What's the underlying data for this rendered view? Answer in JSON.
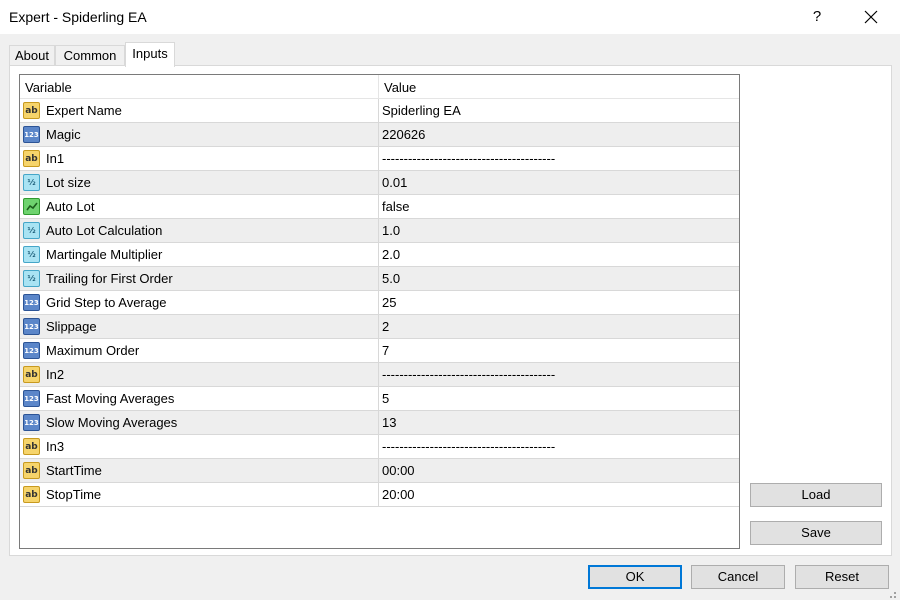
{
  "window": {
    "title": "Expert - Spiderling EA",
    "help_label": "?"
  },
  "tabs": [
    {
      "label": "About"
    },
    {
      "label": "Common"
    },
    {
      "label": "Inputs"
    }
  ],
  "active_tab": "Inputs",
  "table": {
    "columns": [
      "Variable",
      "Value"
    ],
    "rows": [
      {
        "type": "string",
        "icon": "ab",
        "variable": "Expert Name",
        "value": "Spiderling EA"
      },
      {
        "type": "int",
        "icon": "123",
        "variable": "Magic",
        "value": "220626"
      },
      {
        "type": "string",
        "icon": "ab",
        "variable": "In1",
        "value": "----------------------------------------"
      },
      {
        "type": "double",
        "icon": "½",
        "variable": "Lot size",
        "value": "0.01"
      },
      {
        "type": "bool",
        "icon": "bool",
        "variable": "Auto Lot",
        "value": "false"
      },
      {
        "type": "double",
        "icon": "½",
        "variable": "Auto Lot Calculation",
        "value": "1.0"
      },
      {
        "type": "double",
        "icon": "½",
        "variable": "Martingale Multiplier",
        "value": "2.0"
      },
      {
        "type": "double",
        "icon": "½",
        "variable": "Trailing for First Order",
        "value": "5.0"
      },
      {
        "type": "int",
        "icon": "123",
        "variable": "Grid Step to Average",
        "value": "25"
      },
      {
        "type": "int",
        "icon": "123",
        "variable": "Slippage",
        "value": "2"
      },
      {
        "type": "int",
        "icon": "123",
        "variable": "Maximum Order",
        "value": "7"
      },
      {
        "type": "string",
        "icon": "ab",
        "variable": "In2",
        "value": "----------------------------------------"
      },
      {
        "type": "int",
        "icon": "123",
        "variable": "Fast Moving Averages",
        "value": "5"
      },
      {
        "type": "int",
        "icon": "123",
        "variable": "Slow Moving Averages",
        "value": "13"
      },
      {
        "type": "string",
        "icon": "ab",
        "variable": "In3",
        "value": "----------------------------------------"
      },
      {
        "type": "string",
        "icon": "ab",
        "variable": "StartTime",
        "value": "00:00"
      },
      {
        "type": "string",
        "icon": "ab",
        "variable": "StopTime",
        "value": "20:00"
      }
    ]
  },
  "side_buttons": {
    "load": "Load",
    "save": "Save"
  },
  "footer_buttons": {
    "ok": "OK",
    "cancel": "Cancel",
    "reset": "Reset"
  },
  "colors": {
    "accent": "#0078d7",
    "row_alt": "#eeeeee",
    "string_icon": "#f6d46b",
    "int_icon": "#5b86c9",
    "double_icon": "#a9e3f3",
    "bool_icon": "#6ed36e"
  }
}
